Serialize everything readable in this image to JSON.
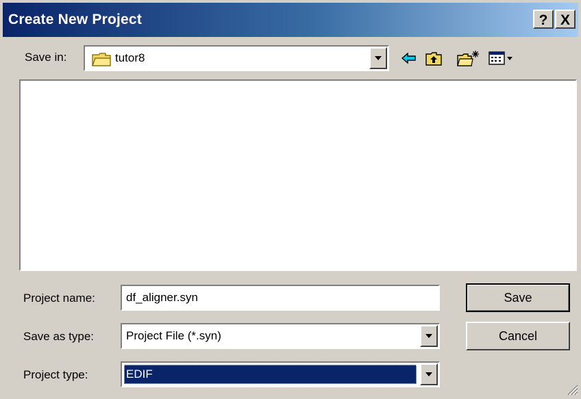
{
  "dialog": {
    "title": "Create New Project",
    "help_label": "?",
    "close_label": "X"
  },
  "save_in": {
    "label": "Save in:",
    "value": "tutor8",
    "icon": "folder-icon"
  },
  "toolbar": {
    "back_icon": "back-arrow-icon",
    "up_icon": "up-one-level-icon",
    "new_folder_icon": "new-folder-icon",
    "view_menu_icon": "view-menu-icon"
  },
  "form": {
    "project_name_label": "Project name:",
    "project_name_value": "df_aligner.syn",
    "save_as_type_label": "Save as type:",
    "save_as_type_value": "Project File (*.syn)",
    "project_type_label": "Project type:",
    "project_type_value": "EDIF"
  },
  "buttons": {
    "save": "Save",
    "cancel": "Cancel"
  },
  "colors": {
    "selection": "#0a246a",
    "face": "#d4d0c8",
    "title_gradient_start": "#0a246a",
    "title_gradient_end": "#a6caf0"
  }
}
